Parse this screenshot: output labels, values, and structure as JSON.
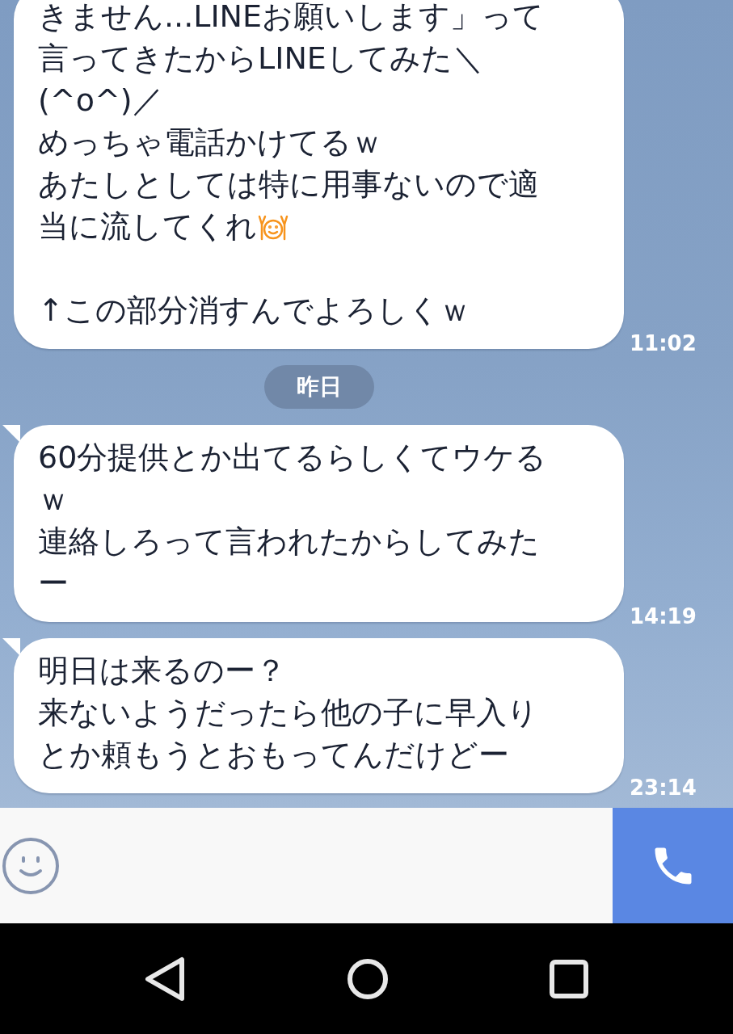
{
  "messages": [
    {
      "lines": [
        {
          "kind": "text",
          "text": "きません...LINEお願いします」って"
        },
        {
          "kind": "text",
          "text": "言ってきたからLINEしてみた＼"
        },
        {
          "kind": "text",
          "text": "(^o^)／"
        },
        {
          "kind": "text",
          "text": "めっちゃ電話かけてるｗ"
        },
        {
          "kind": "text",
          "text": "あたしとしては特に用事ないので適"
        },
        {
          "kind": "text",
          "text": "当に流してくれ",
          "sticker": true
        },
        {
          "kind": "blank"
        },
        {
          "kind": "text",
          "text": "↑この部分消すんでよろしくｗ"
        }
      ],
      "time": "11:02",
      "tail": false
    },
    {
      "kind": "date",
      "label": "昨日"
    },
    {
      "lines": [
        {
          "kind": "text",
          "text": "60分提供とか出てるらしくてウケる"
        },
        {
          "kind": "text",
          "text": "ｗ"
        },
        {
          "kind": "text",
          "text": "連絡しろって言われたからしてみた"
        },
        {
          "kind": "text",
          "text": "ー"
        }
      ],
      "time": "14:19",
      "tail": true
    },
    {
      "lines": [
        {
          "kind": "text",
          "text": "明日は来るのー？"
        },
        {
          "kind": "text",
          "text": "来ないようだったら他の子に早入り"
        },
        {
          "kind": "text",
          "text": "とか頼もうとおもってんだけどー"
        }
      ],
      "time": "23:14",
      "tail": true
    }
  ],
  "input": {
    "kind": "call"
  }
}
